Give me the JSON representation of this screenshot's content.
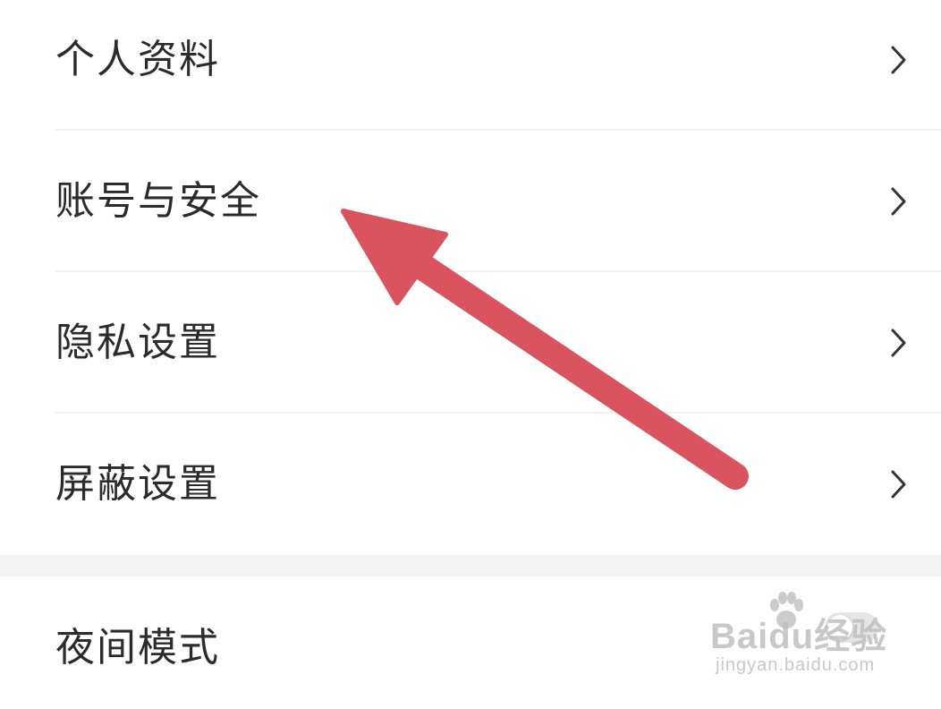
{
  "settings_group_1": {
    "items": [
      {
        "label": "个人资料"
      },
      {
        "label": "账号与安全"
      },
      {
        "label": "隐私设置"
      },
      {
        "label": "屏蔽设置"
      }
    ]
  },
  "settings_group_2": {
    "night_mode": {
      "label": "夜间模式",
      "enabled": false
    }
  },
  "watermark": {
    "brand": "Baidu经验",
    "url": "jingyan.baidu.com"
  },
  "colors": {
    "annotation_arrow": "#d9545e",
    "text": "#2b2b2b",
    "chevron": "#333333",
    "divider": "#f1f1f1"
  },
  "icons": {
    "chevron": "chevron-right-icon",
    "arrow": "arrow-up-left-icon"
  }
}
